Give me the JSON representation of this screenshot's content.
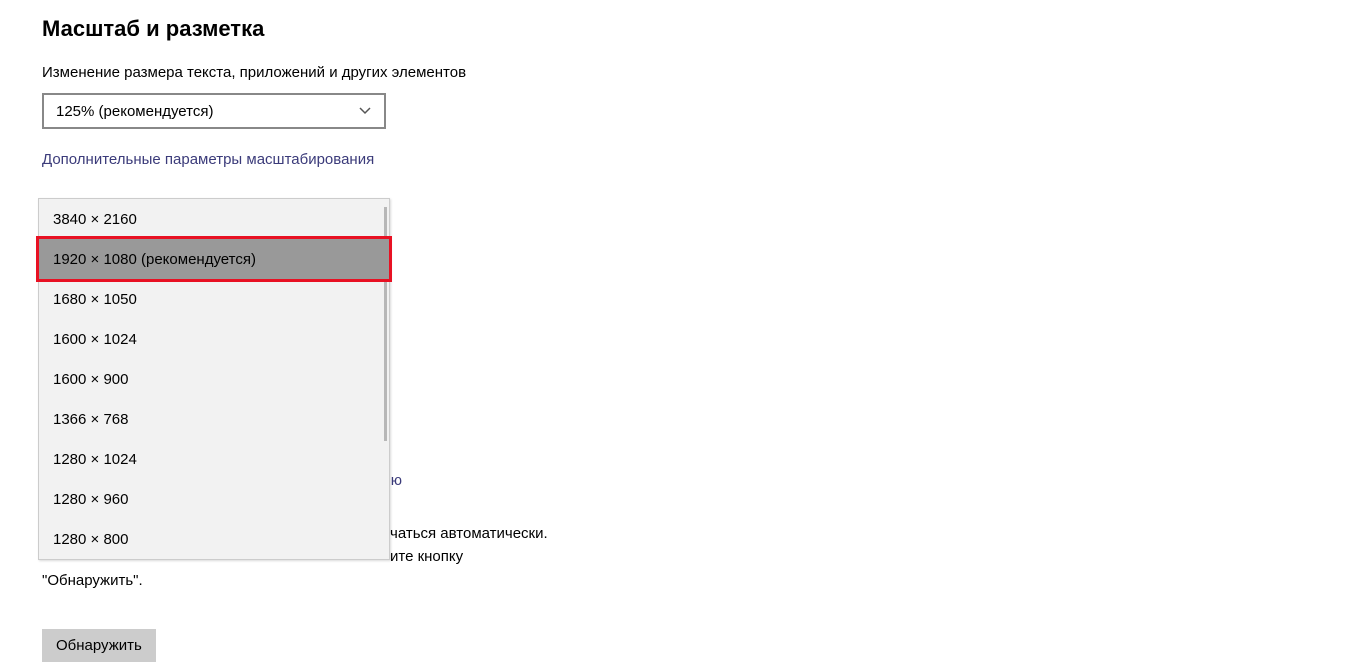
{
  "scale_section": {
    "heading": "Масштаб и разметка",
    "size_label": "Изменение размера текста, приложений и других элементов",
    "scale_value": "125% (рекомендуется)",
    "adv_link": "Дополнительные параметры масштабирования"
  },
  "resolution_dropdown": {
    "items": [
      {
        "label": "3840 × 2160",
        "selected": false
      },
      {
        "label": "1920 × 1080 (рекомендуется)",
        "selected": true
      },
      {
        "label": "1680 × 1050",
        "selected": false
      },
      {
        "label": "1600 × 1024",
        "selected": false
      },
      {
        "label": "1600 × 900",
        "selected": false
      },
      {
        "label": "1366 × 768",
        "selected": false
      },
      {
        "label": "1280 × 1024",
        "selected": false
      },
      {
        "label": "1280 × 960",
        "selected": false
      },
      {
        "label": "1280 × 800",
        "selected": false
      }
    ]
  },
  "partial_link_visible_tail": "ю",
  "explain": {
    "line1_tail": "чаться автоматически.",
    "line2_tail": "ите кнопку",
    "line3": "\"Обнаружить\"."
  },
  "detect_button_label": "Обнаружить"
}
